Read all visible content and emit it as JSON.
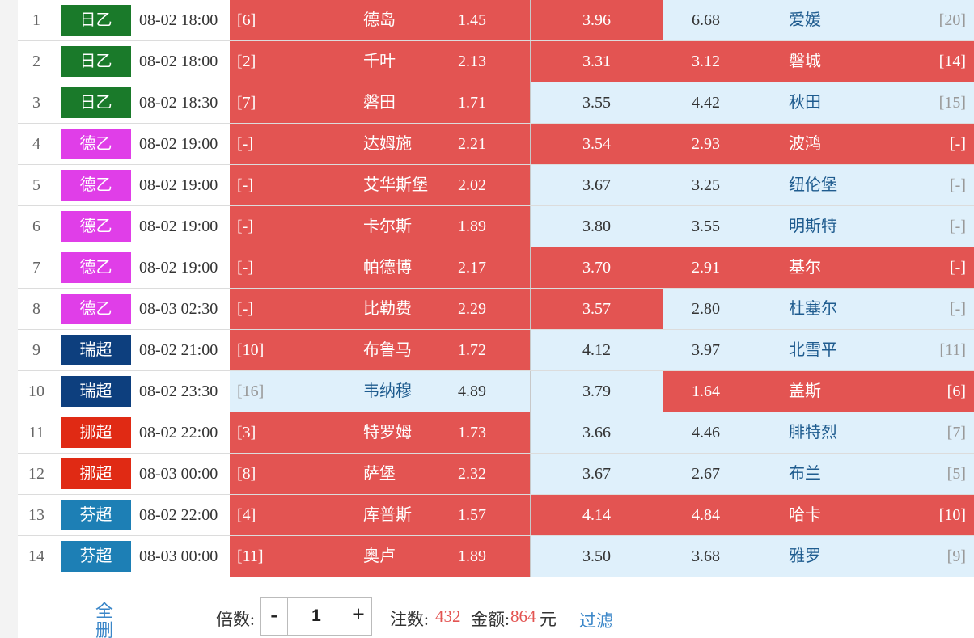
{
  "colors": {
    "selected": "#e35452",
    "unselected": "#dff0fb",
    "accent": "#3a86c8"
  },
  "matches": [
    {
      "num": "1",
      "league": "日乙",
      "league_color": "#1a7a2a",
      "time": "08-02 18:00",
      "home_rank": "[6]",
      "home": "德岛",
      "home_odds": "1.45",
      "draw_odds": "3.96",
      "away_odds": "6.68",
      "away": "爱媛",
      "away_rank": "[20]",
      "sel": [
        true,
        true,
        false
      ]
    },
    {
      "num": "2",
      "league": "日乙",
      "league_color": "#1a7a2a",
      "time": "08-02 18:00",
      "home_rank": "[2]",
      "home": "千叶",
      "home_odds": "2.13",
      "draw_odds": "3.31",
      "away_odds": "3.12",
      "away": "磐城",
      "away_rank": "[14]",
      "sel": [
        true,
        true,
        true
      ]
    },
    {
      "num": "3",
      "league": "日乙",
      "league_color": "#1a7a2a",
      "time": "08-02 18:30",
      "home_rank": "[7]",
      "home": "磐田",
      "home_odds": "1.71",
      "draw_odds": "3.55",
      "away_odds": "4.42",
      "away": "秋田",
      "away_rank": "[15]",
      "sel": [
        true,
        false,
        false
      ]
    },
    {
      "num": "4",
      "league": "德乙",
      "league_color": "#e03ee8",
      "time": "08-02 19:00",
      "home_rank": "[-]",
      "home": "达姆施",
      "home_odds": "2.21",
      "draw_odds": "3.54",
      "away_odds": "2.93",
      "away": "波鸿",
      "away_rank": "[-]",
      "sel": [
        true,
        true,
        true
      ]
    },
    {
      "num": "5",
      "league": "德乙",
      "league_color": "#e03ee8",
      "time": "08-02 19:00",
      "home_rank": "[-]",
      "home": "艾华斯堡",
      "home_odds": "2.02",
      "draw_odds": "3.67",
      "away_odds": "3.25",
      "away": "纽伦堡",
      "away_rank": "[-]",
      "sel": [
        true,
        false,
        false
      ]
    },
    {
      "num": "6",
      "league": "德乙",
      "league_color": "#e03ee8",
      "time": "08-02 19:00",
      "home_rank": "[-]",
      "home": "卡尔斯",
      "home_odds": "1.89",
      "draw_odds": "3.80",
      "away_odds": "3.55",
      "away": "明斯特",
      "away_rank": "[-]",
      "sel": [
        true,
        false,
        false
      ]
    },
    {
      "num": "7",
      "league": "德乙",
      "league_color": "#e03ee8",
      "time": "08-02 19:00",
      "home_rank": "[-]",
      "home": "帕德博",
      "home_odds": "2.17",
      "draw_odds": "3.70",
      "away_odds": "2.91",
      "away": "基尔",
      "away_rank": "[-]",
      "sel": [
        true,
        true,
        true
      ]
    },
    {
      "num": "8",
      "league": "德乙",
      "league_color": "#e03ee8",
      "time": "08-03 02:30",
      "home_rank": "[-]",
      "home": "比勒费",
      "home_odds": "2.29",
      "draw_odds": "3.57",
      "away_odds": "2.80",
      "away": "杜塞尔",
      "away_rank": "[-]",
      "sel": [
        true,
        true,
        false
      ]
    },
    {
      "num": "9",
      "league": "瑞超",
      "league_color": "#0d3f7e",
      "time": "08-02 21:00",
      "home_rank": "[10]",
      "home": "布鲁马",
      "home_odds": "1.72",
      "draw_odds": "4.12",
      "away_odds": "3.97",
      "away": "北雪平",
      "away_rank": "[11]",
      "sel": [
        true,
        false,
        false
      ]
    },
    {
      "num": "10",
      "league": "瑞超",
      "league_color": "#0d3f7e",
      "time": "08-02 23:30",
      "home_rank": "[16]",
      "home": "韦纳穆",
      "home_odds": "4.89",
      "draw_odds": "3.79",
      "away_odds": "1.64",
      "away": "盖斯",
      "away_rank": "[6]",
      "sel": [
        false,
        false,
        true
      ]
    },
    {
      "num": "11",
      "league": "挪超",
      "league_color": "#e02a14",
      "time": "08-02 22:00",
      "home_rank": "[3]",
      "home": "特罗姆",
      "home_odds": "1.73",
      "draw_odds": "3.66",
      "away_odds": "4.46",
      "away": "腓特烈",
      "away_rank": "[7]",
      "sel": [
        true,
        false,
        false
      ]
    },
    {
      "num": "12",
      "league": "挪超",
      "league_color": "#e02a14",
      "time": "08-03 00:00",
      "home_rank": "[8]",
      "home": "萨堡",
      "home_odds": "2.32",
      "draw_odds": "3.67",
      "away_odds": "2.67",
      "away": "布兰",
      "away_rank": "[5]",
      "sel": [
        true,
        false,
        false
      ]
    },
    {
      "num": "13",
      "league": "芬超",
      "league_color": "#1d7fb5",
      "time": "08-02 22:00",
      "home_rank": "[4]",
      "home": "库普斯",
      "home_odds": "1.57",
      "draw_odds": "4.14",
      "away_odds": "4.84",
      "away": "哈卡",
      "away_rank": "[10]",
      "sel": [
        true,
        true,
        true
      ]
    },
    {
      "num": "14",
      "league": "芬超",
      "league_color": "#1d7fb5",
      "time": "08-03 00:00",
      "home_rank": "[11]",
      "home": "奥卢",
      "home_odds": "1.89",
      "draw_odds": "3.50",
      "away_odds": "3.68",
      "away": "雅罗",
      "away_rank": "[9]",
      "sel": [
        true,
        false,
        false
      ]
    }
  ],
  "footer": {
    "clear_all": "全删",
    "multiplier_label": "倍数:",
    "minus": "-",
    "plus": "+",
    "multiplier_value": "1",
    "bets_label": "注数:",
    "bets_value": "432",
    "amount_label": "金额:",
    "amount_value": "864",
    "amount_unit": "元",
    "filter": "过滤"
  }
}
